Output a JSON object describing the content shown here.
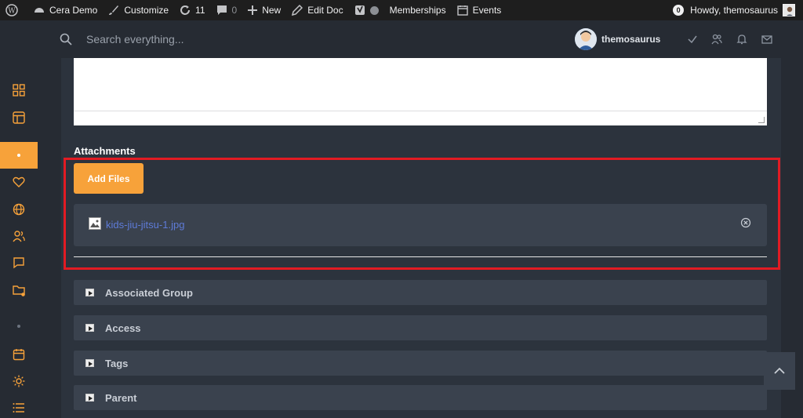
{
  "adminbar": {
    "site_name": "Cera Demo",
    "customize": "Customize",
    "updates_count": "11",
    "comments_count": "0",
    "new_label": "New",
    "edit_doc": "Edit Doc",
    "memberships": "Memberships",
    "events": "Events",
    "notif_count": "0",
    "howdy": "Howdy, themosaurus"
  },
  "topbar": {
    "search_placeholder": "Search everything...",
    "user_name": "themosaurus"
  },
  "attachments": {
    "title": "Attachments",
    "add_files_label": "Add Files",
    "file_name": "kids-jiu-jitsu-1.jpg"
  },
  "sections": [
    {
      "label": "Associated Group"
    },
    {
      "label": "Access"
    },
    {
      "label": "Tags"
    },
    {
      "label": "Parent"
    }
  ],
  "colors": {
    "accent": "#f7a23a",
    "highlight_border": "#e21b23",
    "link": "#5e7bd8"
  }
}
